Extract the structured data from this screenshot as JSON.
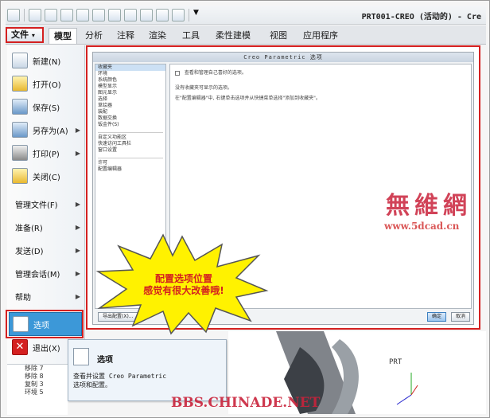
{
  "window": {
    "title": "PRT001-CREO (活动的) - Cre"
  },
  "file_tab": {
    "label": "文件",
    "arrow": "▾"
  },
  "tabs": [
    {
      "label": "模型",
      "active": true
    },
    {
      "label": "分析"
    },
    {
      "label": "注释"
    },
    {
      "label": "渲染"
    },
    {
      "label": "工具"
    },
    {
      "label": "柔性建模"
    },
    {
      "label": "视图"
    },
    {
      "label": "应用程序"
    }
  ],
  "file_menu": {
    "items": [
      {
        "label": "新建(N)",
        "icon": "new-file-icon",
        "has_arrow": false
      },
      {
        "label": "打开(O)",
        "icon": "open-folder-icon",
        "has_arrow": false
      },
      {
        "label": "保存(S)",
        "icon": "save-icon",
        "has_arrow": false
      },
      {
        "label": "另存为(A)",
        "icon": "save-as-icon",
        "has_arrow": true
      },
      {
        "label": "打印(P)",
        "icon": "printer-icon",
        "has_arrow": true
      },
      {
        "label": "关闭(C)",
        "icon": "close-folder-icon",
        "has_arrow": false
      }
    ],
    "plain_items": [
      {
        "label": "管理文件(F)",
        "has_arrow": true
      },
      {
        "label": "准备(R)",
        "has_arrow": true
      },
      {
        "label": "发送(D)",
        "has_arrow": true
      },
      {
        "label": "管理会话(M)",
        "has_arrow": true
      },
      {
        "label": "帮助",
        "has_arrow": true
      }
    ],
    "selected": {
      "label": "选项",
      "icon": "options-icon"
    },
    "exit": {
      "label": "退出(X)",
      "icon": "exit-icon"
    }
  },
  "options_dialog": {
    "title": "Creo Parametric 选项",
    "categories_group1": [
      "收藏夹",
      "环境",
      "系统颜色",
      "模型显示",
      "图元显示",
      "选择",
      "草绘器",
      "装配",
      "数据交换",
      "钣金件(S)"
    ],
    "categories_group2": [
      "自定义功能区",
      "快速访问工具栏",
      "窗口设置"
    ],
    "categories_group3": [
      "许可",
      "配置编辑器"
    ],
    "checkbox_label": "查看和管理自己喜好的选项。",
    "body_lines": [
      "没有收藏夹可显示的选项。",
      "在\"配置编辑器\"中, 右键单击选项并从快捷菜单选择\"添加到收藏夹\"。"
    ],
    "export_button": "导出配置(X)...",
    "ok_button": "确定",
    "cancel_button": "取消"
  },
  "callout": {
    "line1": "配置选项位置",
    "line2": "感觉有很大改善哦!"
  },
  "tooltip": {
    "title": "选项",
    "description_line1": "查看并设置 Creo Parametric",
    "description_line2": "选项和配置。"
  },
  "model_tree": [
    "移除 7",
    "移除 8",
    "复制 3",
    "环境 5"
  ],
  "watermark": {
    "logo": "無維網",
    "site": "www.5dcad.cn",
    "forum": "BBS.CHINADE.NET"
  },
  "graphics": {
    "prt_label": "PRT"
  },
  "colors": {
    "highlight_red": "#d42020",
    "selected_blue": "#3c98d8",
    "callout_yellow": "#fff200"
  }
}
